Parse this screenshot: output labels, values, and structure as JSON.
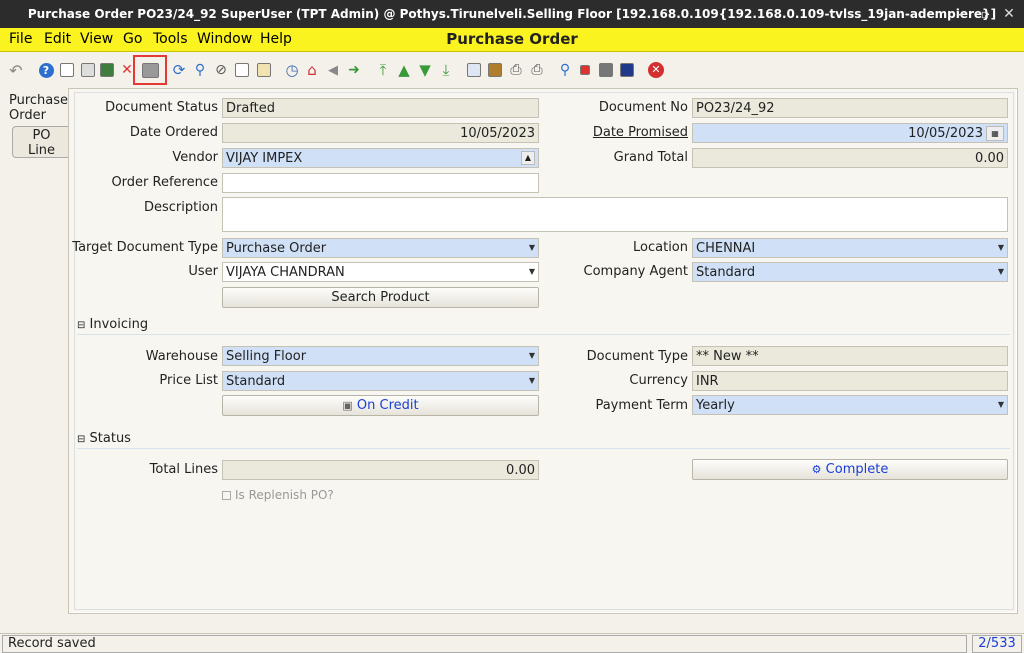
{
  "window": {
    "title": "Purchase Order  PO23/24_92  SuperUser (TPT Admin) @ Pothys.Tirunelveli.Selling Floor [192.168.0.109{192.168.0.109-tvlss_19jan-adempiere}]"
  },
  "menu": {
    "file": "File",
    "edit": "Edit",
    "view": "View",
    "go": "Go",
    "tools": "Tools",
    "window": "Window",
    "help": "Help",
    "window_title": "Purchase Order"
  },
  "tabs": {
    "purchase_order": "Purchase Order",
    "po_line": "PO Line"
  },
  "form": {
    "document_status_label": "Document Status",
    "document_status": "Drafted",
    "document_no_label": "Document No",
    "document_no": "PO23/24_92",
    "date_ordered_label": "Date Ordered",
    "date_ordered": "10/05/2023",
    "date_promised_label": "Date Promised",
    "date_promised": "10/05/2023",
    "vendor_label": "Vendor",
    "vendor": "VIJAY IMPEX",
    "grand_total_label": "Grand Total",
    "grand_total": "0.00",
    "order_reference_label": "Order Reference",
    "order_reference": "",
    "description_label": "Description",
    "description": "",
    "target_doc_type_label": "Target Document Type",
    "target_doc_type": "Purchase Order",
    "location_label": "Location",
    "location": "CHENNAI",
    "user_label": "User",
    "user": "VIJAYA CHANDRAN",
    "company_agent_label": "Company Agent",
    "company_agent": "Standard",
    "search_product_button": "Search Product"
  },
  "invoicing": {
    "section_title": "Invoicing",
    "warehouse_label": "Warehouse",
    "warehouse": "Selling Floor",
    "document_type_label": "Document Type",
    "document_type": "** New **",
    "price_list_label": "Price List",
    "price_list": "Standard",
    "currency_label": "Currency",
    "currency": "INR",
    "on_credit_button": "On Credit",
    "payment_term_label": "Payment Term",
    "payment_term": "Yearly"
  },
  "status_section": {
    "section_title": "Status",
    "total_lines_label": "Total Lines",
    "total_lines": "0.00",
    "complete_button": "Complete",
    "replenish_label": "Is Replenish PO?"
  },
  "statusbar": {
    "message": "Record saved",
    "record_count": "2/533"
  }
}
